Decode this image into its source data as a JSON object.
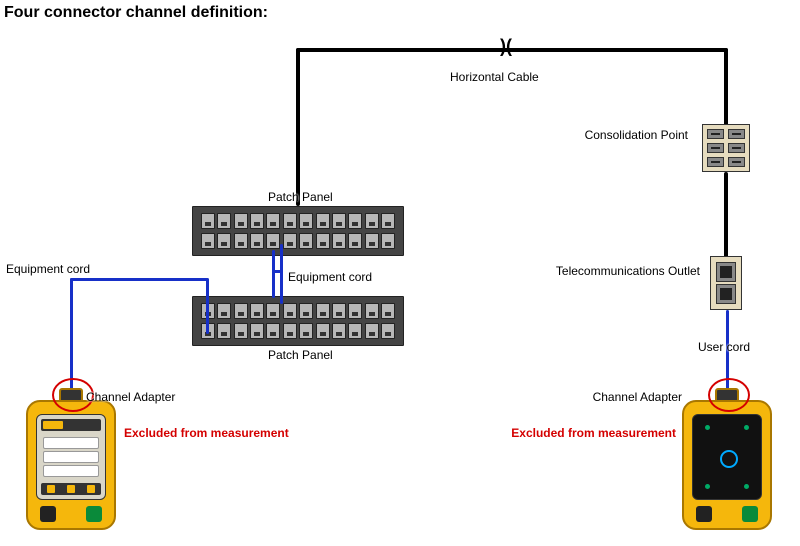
{
  "title": "Four connector channel definition:",
  "labels": {
    "horizontal_cable": "Horizontal Cable",
    "consolidation_point": "Consolidation Point",
    "telecom_outlet": "Telecommunications Outlet",
    "patch_panel_top": "Patch Panel",
    "patch_panel_bottom": "Patch Panel",
    "equipment_cord_left": "Equipment cord",
    "equipment_cord_mid": "Equipment cord",
    "user_cord": "User cord",
    "channel_adapter_left": "Channel Adapter",
    "channel_adapter_right": "Channel Adapter",
    "excluded_left": "Excluded from measurement",
    "excluded_right": "Excluded from measurement"
  },
  "colors": {
    "cable_backbone": "#000000",
    "cable_patch": "#1730c8",
    "excluded": "#d40000",
    "tester_body": "#f5b70c"
  },
  "components": {
    "patch_panels": 2,
    "patch_panel_ports_per_row": 12,
    "patch_panel_rows": 2,
    "consolidation_point_jacks": 6,
    "telecom_outlet_jacks": 2,
    "testers": [
      "main",
      "remote"
    ]
  }
}
